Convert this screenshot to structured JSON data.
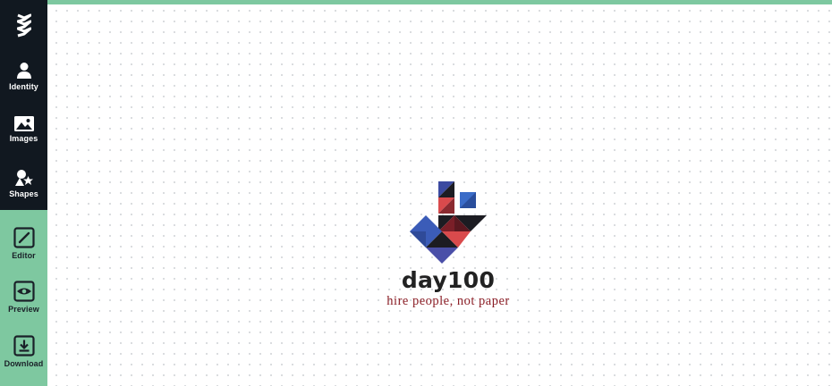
{
  "sidebar": {
    "logo": "WW",
    "items": [
      {
        "label": "Identity",
        "icon": "person-icon"
      },
      {
        "label": "Images",
        "icon": "image-icon"
      },
      {
        "label": "Shapes",
        "icon": "shapes-icon"
      },
      {
        "label": "Editor",
        "icon": "edit-icon"
      },
      {
        "label": "Preview",
        "icon": "eye-icon"
      },
      {
        "label": "Download",
        "icon": "download-icon"
      }
    ],
    "colors": {
      "dark": "#111820",
      "accent": "#7ec8a0"
    }
  },
  "canvas": {
    "brand_name": "day100",
    "tagline": "hire people, not paper",
    "colors": {
      "blue": "#3b5cb8",
      "red": "#d94a4c",
      "dark": "#1c1c22",
      "maroon": "#7a1f28"
    }
  }
}
